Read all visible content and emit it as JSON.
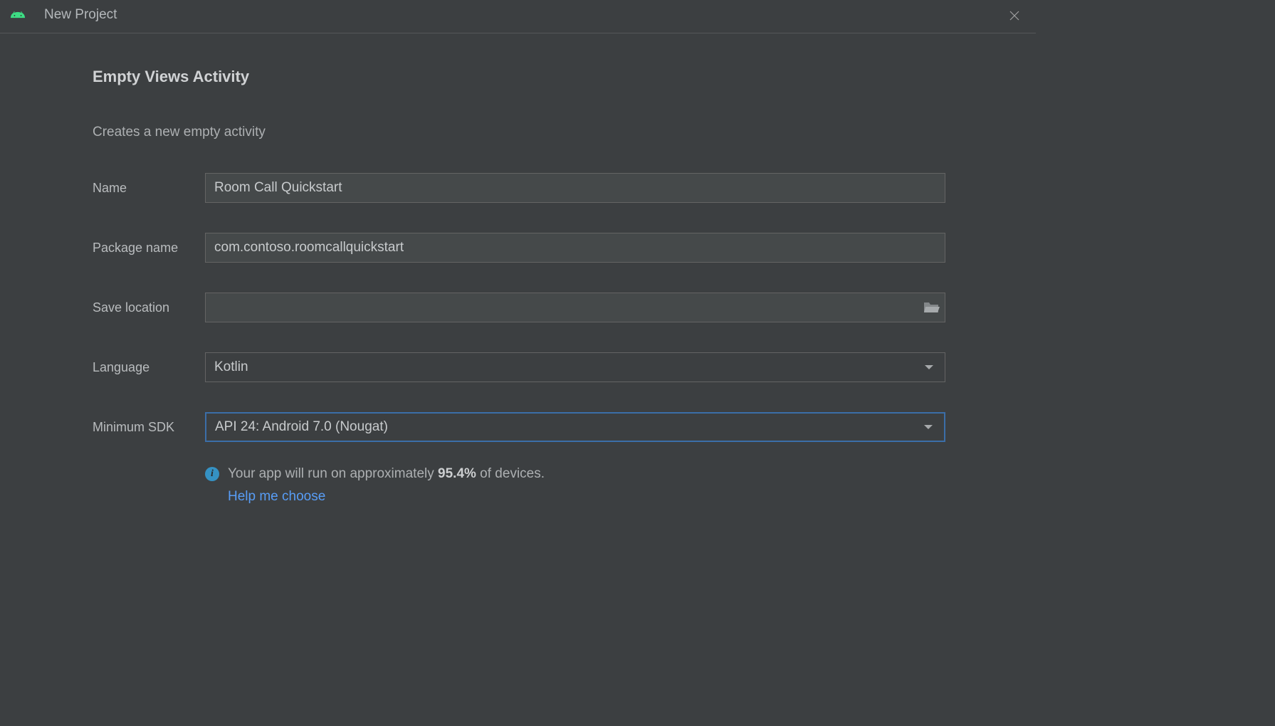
{
  "window": {
    "title": "New Project"
  },
  "header": {
    "page_title": "Empty Views Activity",
    "subtitle": "Creates a new empty activity"
  },
  "form": {
    "name_label": "Name",
    "name_value": "Room Call Quickstart",
    "package_label": "Package name",
    "package_value": "com.contoso.roomcallquickstart",
    "location_label": "Save location",
    "location_value": "",
    "language_label": "Language",
    "language_value": "Kotlin",
    "sdk_label": "Minimum SDK",
    "sdk_value": "API 24: Android 7.0 (Nougat)"
  },
  "info": {
    "text_prefix": "Your app will run on approximately ",
    "percent": "95.4%",
    "text_suffix": " of devices.",
    "help_link": "Help me choose"
  }
}
